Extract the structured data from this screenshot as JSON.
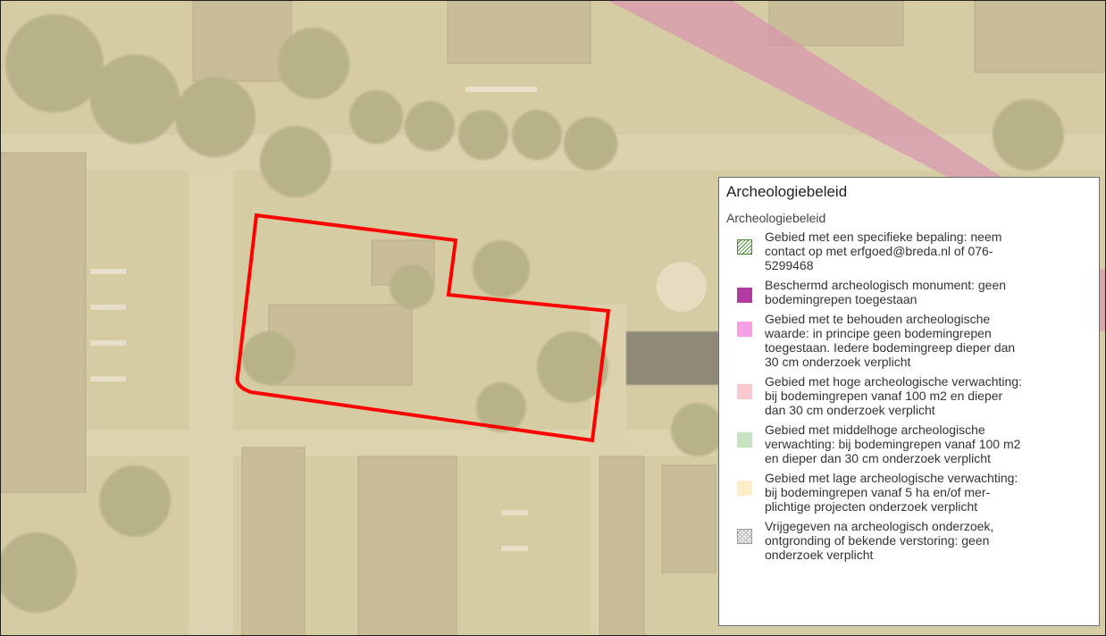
{
  "legend": {
    "title": "Archeologiebeleid",
    "layer_name": "Archeologiebeleid",
    "items": [
      {
        "label": "Gebied met een specifieke bepaling: neem\ncontact op met erfgoed@breda.nl of 076-\n5299468",
        "pattern": "diagonal-hatch",
        "color": "#3f8f2f"
      },
      {
        "label": "Beschermd archeologisch monument: geen\nbodemingrepen toegestaan",
        "pattern": "solid",
        "color": "#b03aa0"
      },
      {
        "label": "Gebied met te behouden archeologische\nwaarde: in principe geen bodemingrepen\ntoegestaan. Iedere bodemingreep dieper dan\n30 cm onderzoek verplicht",
        "pattern": "solid",
        "color": "#f49fe6"
      },
      {
        "label": "Gebied met hoge archeologische verwachting:\nbij bodemingrepen vanaf 100 m2 en dieper\ndan 30 cm onderzoek verplicht",
        "pattern": "solid",
        "color": "#f9c9cf"
      },
      {
        "label": "Gebied met middelhoge archeologische\nverwachting: bij bodemingrepen vanaf 100 m2\nen dieper dan 30 cm onderzoek verplicht",
        "pattern": "solid",
        "color": "#c6e3bf"
      },
      {
        "label": "Gebied met lage archeologische verwachting:\nbij bodemingrepen vanaf 5 ha en/of mer-\nplichtige projecten onderzoek verplicht",
        "pattern": "solid",
        "color": "#fdedc9"
      },
      {
        "label": "Vrijgegeven na archeologisch onderzoek,\nontgronding of bekende verstoring: geen\nonderzoek verplicht",
        "pattern": "cross-hatch",
        "color": "#9a9a9a"
      }
    ]
  },
  "map": {
    "base_tint": "#d9cfa8",
    "monument_band_color": "#d890b0",
    "site_outline_color": "#ff0000"
  }
}
